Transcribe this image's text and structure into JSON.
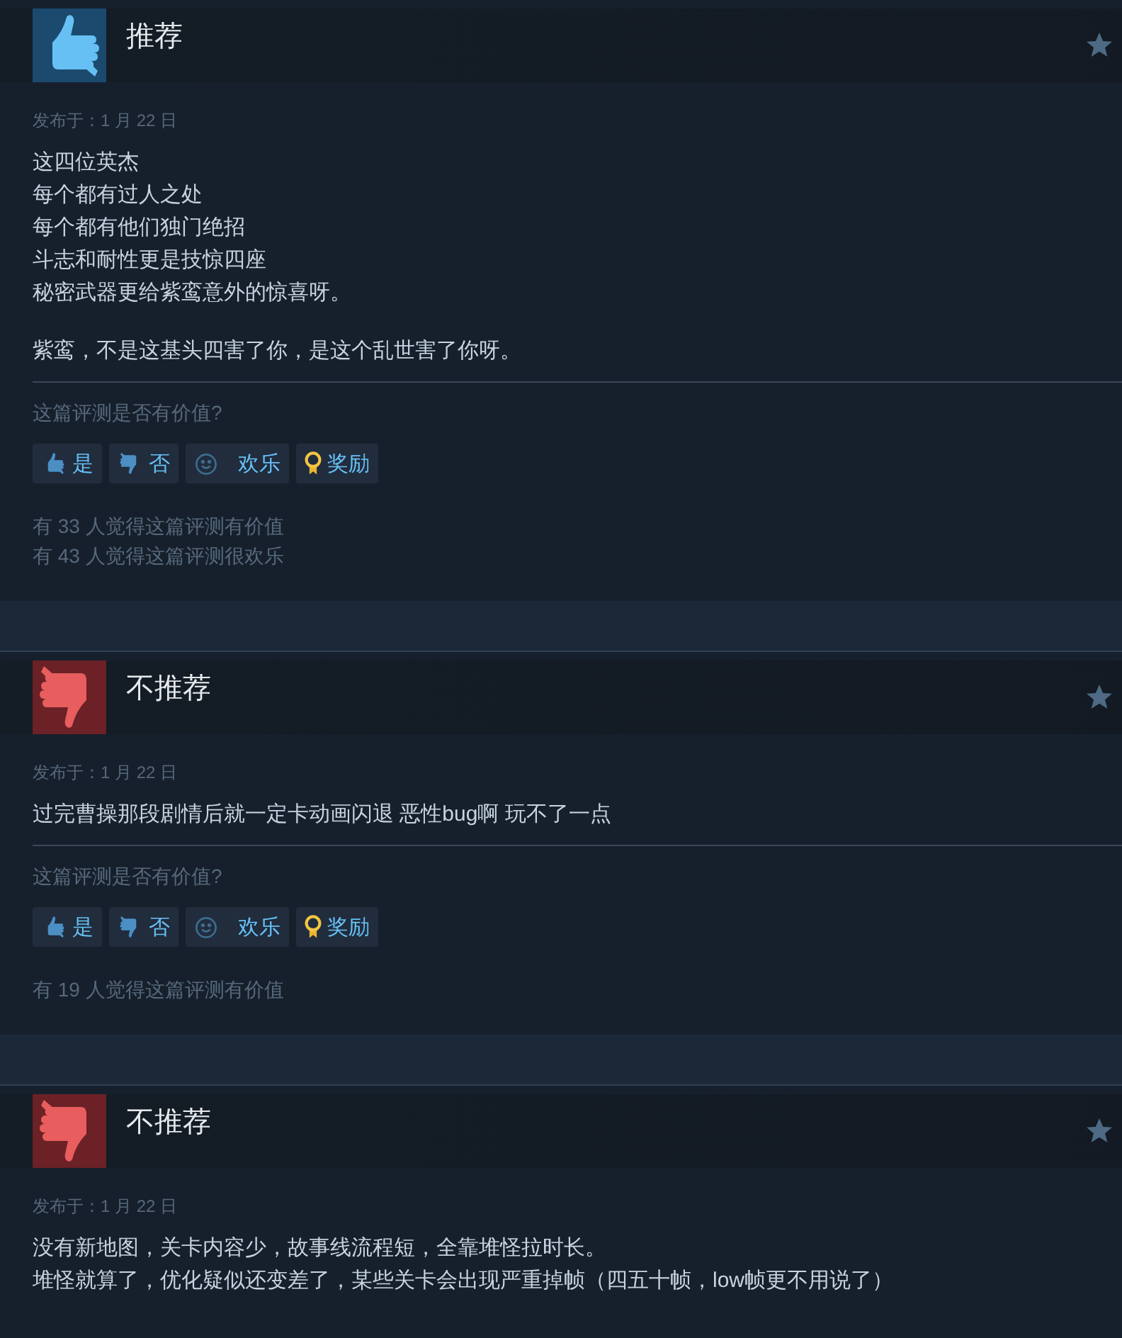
{
  "reviews": [
    {
      "kind": "recommended",
      "title": "推荐",
      "date": "发布于：1 月 22 日",
      "paragraphs": [
        [
          "这四位英杰",
          "每个都有过人之处",
          "每个都有他们独门绝招",
          "斗志和耐性更是技惊四座",
          "秘密武器更给紫鸾意外的惊喜呀。"
        ],
        [
          "紫鸾，不是这基头四害了你，是这个乱世害了你呀。"
        ]
      ],
      "question": "这篇评测是否有价值?",
      "buttons": [
        {
          "kind": "yes",
          "label": "是"
        },
        {
          "kind": "no",
          "label": "否"
        },
        {
          "kind": "funny",
          "label": "欢乐"
        },
        {
          "kind": "award",
          "label": "奖励"
        }
      ],
      "counts": [
        "有 33 人觉得这篇评测有价值",
        "有 43 人觉得这篇评测很欢乐"
      ]
    },
    {
      "kind": "not_recommended",
      "title": "不推荐",
      "date": "发布于：1 月 22 日",
      "paragraphs": [
        [
          "过完曹操那段剧情后就一定卡动画闪退 恶性bug啊 玩不了一点"
        ]
      ],
      "question": "这篇评测是否有价值?",
      "buttons": [
        {
          "kind": "yes",
          "label": "是"
        },
        {
          "kind": "no",
          "label": "否"
        },
        {
          "kind": "funny",
          "label": "欢乐"
        },
        {
          "kind": "award",
          "label": "奖励"
        }
      ],
      "counts": [
        "有 19 人觉得这篇评测有价值"
      ]
    },
    {
      "kind": "not_recommended",
      "title": "不推荐",
      "date": "发布于：1 月 22 日",
      "paragraphs": [
        [
          "没有新地图，关卡内容少，故事线流程短，全靠堆怪拉时长。",
          "堆怪就算了，优化疑似还变差了，某些关卡会出现严重掉帧（四五十帧，low帧更不用说了）"
        ]
      ]
    }
  ]
}
